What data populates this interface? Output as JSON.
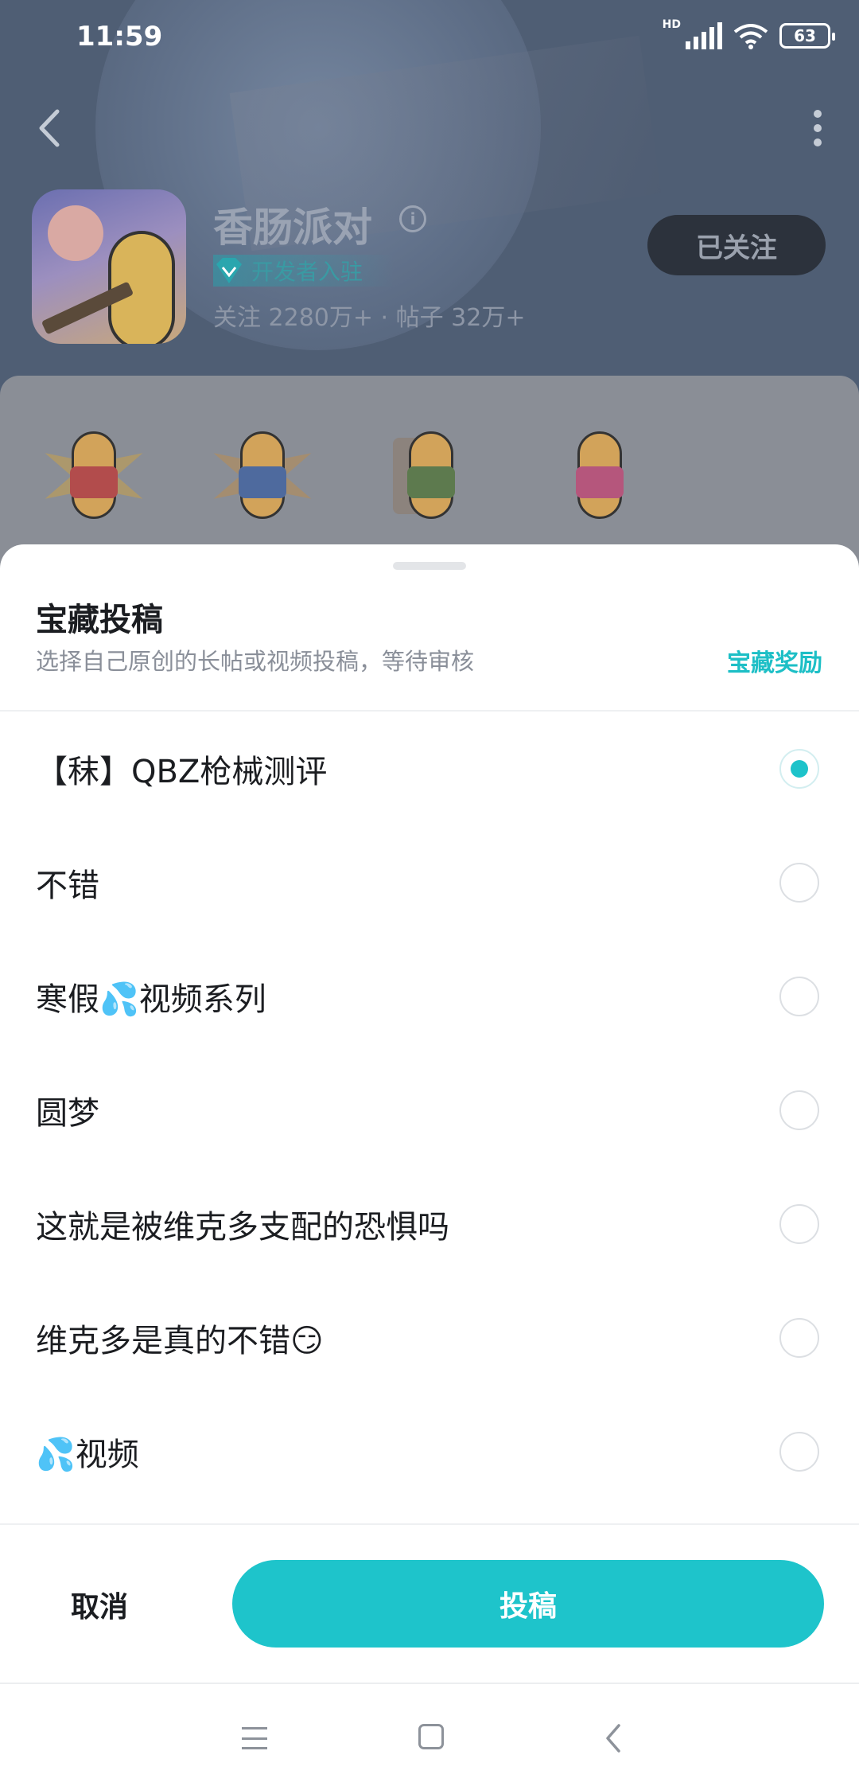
{
  "status_bar": {
    "time": "11:59",
    "network": "HD",
    "battery": "63"
  },
  "game": {
    "title": "香肠派对",
    "badge": "开发者入驻",
    "stats": "关注 2280万+  ·  帖子 32万+",
    "follow_label": "已关注"
  },
  "sheet": {
    "title": "宝藏投稿",
    "subtitle": "选择自己原创的长帖或视频投稿，等待审核",
    "reward_link": "宝藏奖励",
    "posts": [
      {
        "title": "【秣】QBZ枪械测评",
        "selected": true
      },
      {
        "title": "不错",
        "selected": false
      },
      {
        "title": "寒假💦视频系列",
        "selected": false
      },
      {
        "title": "圆梦",
        "selected": false
      },
      {
        "title": "这就是被维克多支配的恐惧吗",
        "selected": false
      },
      {
        "title": "维克多是真的不错😏",
        "selected": false
      },
      {
        "title": "💦视频",
        "selected": false
      }
    ],
    "cancel_label": "取消",
    "submit_label": "投稿"
  },
  "colors": {
    "accent": "#1ec4cb",
    "reward_text": "#1dbfc6"
  }
}
